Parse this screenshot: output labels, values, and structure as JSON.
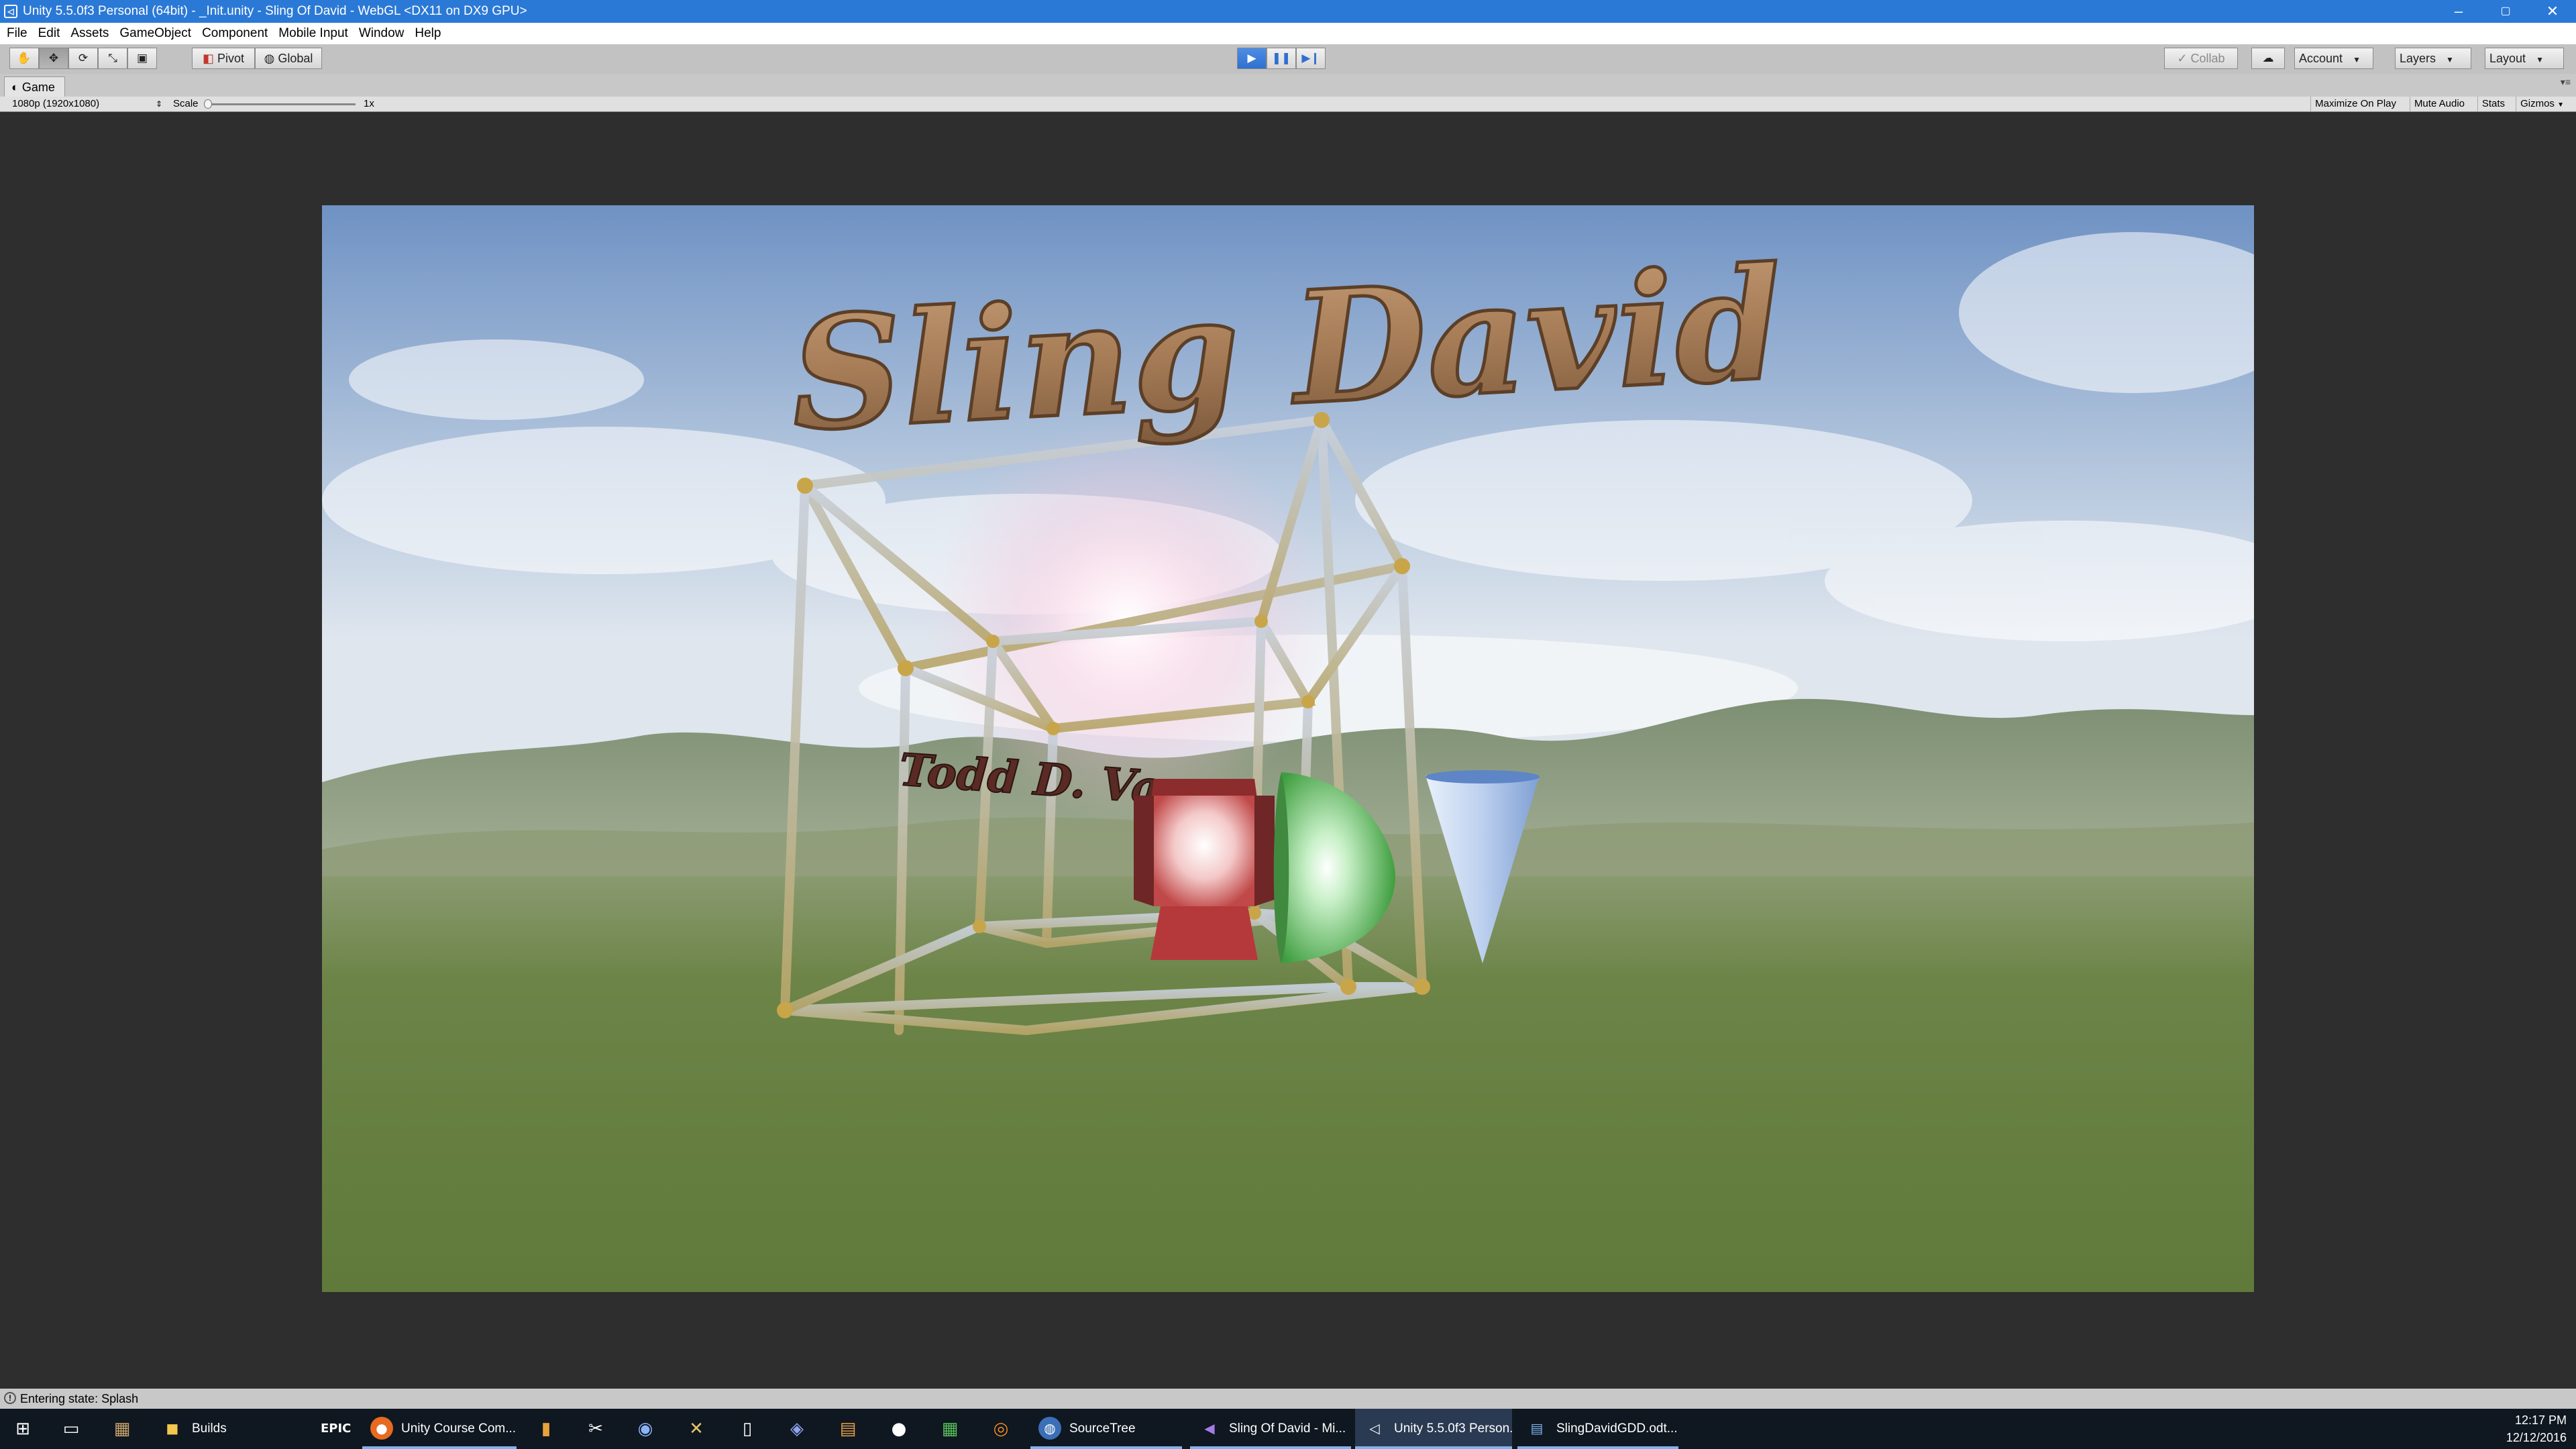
{
  "window": {
    "title": "Unity 5.5.0f3 Personal (64bit) - _Init.unity - Sling Of David - WebGL <DX11 on DX9 GPU>",
    "controls": [
      "–",
      "▢",
      "✕"
    ]
  },
  "menu": [
    "File",
    "Edit",
    "Assets",
    "GameObject",
    "Component",
    "Mobile Input",
    "Window",
    "Help"
  ],
  "toolbar": {
    "tools": [
      "hand-tool",
      "move-tool",
      "rotate-tool",
      "scale-tool",
      "rect-tool"
    ],
    "pivot_label": "Pivot",
    "global_label": "Global",
    "playback": [
      "play",
      "pause",
      "step"
    ],
    "collab_label": "Collab",
    "account_label": "Account",
    "layers_label": "Layers",
    "layout_label": "Layout"
  },
  "game_tab": {
    "label": "Game",
    "resolution": "1080p (1920x1080)",
    "scale_label": "Scale",
    "scale_value": "1x",
    "scale_level": 0,
    "buttons": [
      "Maximize On Play",
      "Mute Audio",
      "Stats",
      "Gizmos"
    ]
  },
  "scene": {
    "logo_title": "Sling David",
    "logo_byline": "Todd D. Vance",
    "colors": {
      "sky_top": "#6f92c4",
      "sky_horizon": "#dfe6ee",
      "grass": "#5f7a3b",
      "logo_stone": "#a67c57",
      "shape_red": "#b5393a",
      "shape_green": "#57b857",
      "shape_blue": "#9fbbe6"
    }
  },
  "status": {
    "message": "Entering state: Splash"
  },
  "taskbar": {
    "apps": [
      {
        "label": "Builds",
        "icon": "folder-icon"
      },
      {
        "label": "Unity Course Com...",
        "icon": "firefox-icon"
      },
      {
        "label": "SourceTree",
        "icon": "sourcetree-icon"
      },
      {
        "label": "Sling Of David - Mi...",
        "icon": "visual-studio-icon"
      },
      {
        "label": "Unity 5.5.0f3 Person...",
        "icon": "unity-icon"
      },
      {
        "label": "SlingDavidGDD.odt...",
        "icon": "document-icon"
      }
    ],
    "time": "12:17 PM",
    "date": "12/12/2016"
  }
}
